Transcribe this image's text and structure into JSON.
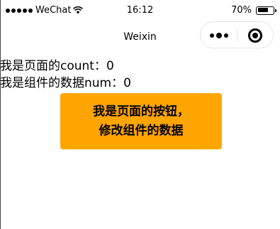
{
  "status_bar": {
    "carrier": "WeChat",
    "time": "16:12",
    "battery_percent_label": "70%",
    "battery_level": 0.7,
    "icons": [
      "signal-dots-icon",
      "wifi-icon",
      "battery-icon"
    ]
  },
  "nav": {
    "title": "Weixin",
    "capsule_icons": [
      "more-icon",
      "close-icon"
    ]
  },
  "content": {
    "page_count_label": "我是页面的count：",
    "page_count_value": "0",
    "component_num_label": "我是组件的数据num：",
    "component_num_value": "0"
  },
  "button": {
    "line1": "我是页面的按钮，",
    "line2": "修改组件的数据",
    "background": "#ffa500"
  }
}
